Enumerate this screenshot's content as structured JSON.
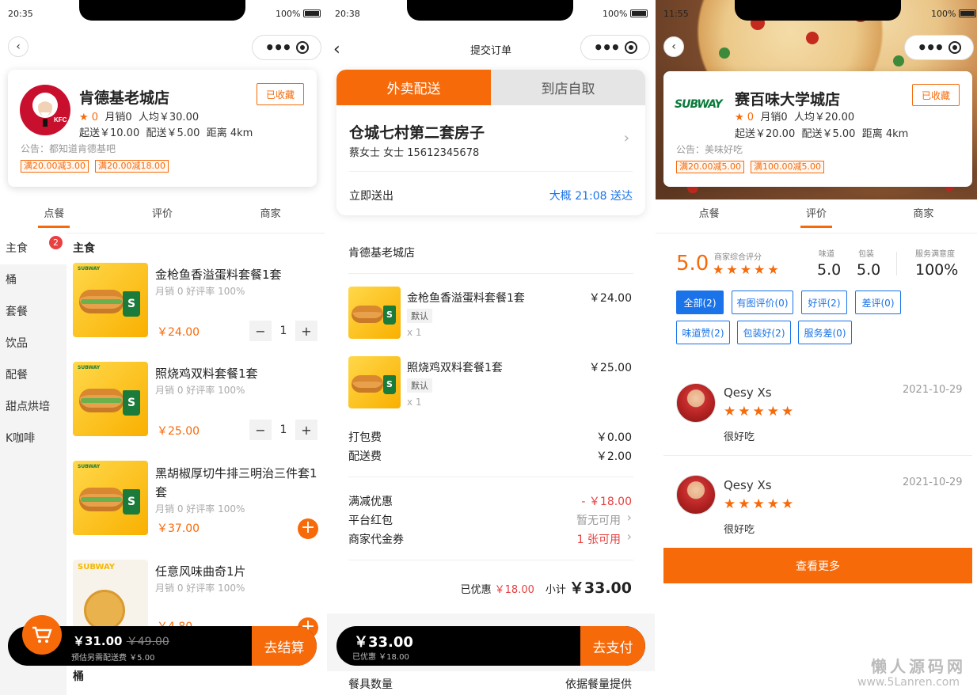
{
  "colors": {
    "accent": "#f66a0a",
    "link": "#1a73e8",
    "red": "#e94040"
  },
  "p1": {
    "time": "20:35",
    "battery": "100%",
    "shop": {
      "name": "肯德基老城店",
      "rating": "0",
      "sales": "月销0",
      "avg": "人均￥30.00",
      "start": "起送￥10.00",
      "delivery": "配送￥5.00",
      "distance": "距离 4km",
      "fav": "已收藏",
      "notice": "公告：都知道肯德基吧",
      "promos": [
        "满20.00减3.00",
        "满20.00减18.00"
      ]
    },
    "tabs": [
      "点餐",
      "评价",
      "商家"
    ],
    "categories": [
      {
        "label": "主食",
        "badge": "2"
      },
      {
        "label": "桶"
      },
      {
        "label": "套餐"
      },
      {
        "label": "饮品"
      },
      {
        "label": "配餐"
      },
      {
        "label": "甜点烘培"
      },
      {
        "label": "K咖啡"
      }
    ],
    "section": "主食",
    "items": [
      {
        "name": "金枪鱼香溢蛋料套餐1套",
        "sub": "月销 0 好评率 100%",
        "price": "￥24.00",
        "qty": "1"
      },
      {
        "name": "照烧鸡双料套餐1套",
        "sub": "月销 0 好评率 100%",
        "price": "￥25.00",
        "qty": "1"
      },
      {
        "name": "黑胡椒厚切牛排三明治三件套1套",
        "sub": "月销 0 好评率 100%",
        "price": "￥37.00"
      },
      {
        "name": "任意风味曲奇1片",
        "sub": "月销 0 好评率 100%",
        "price": "￥4.80"
      }
    ],
    "cart": {
      "total": "￥31.00",
      "old": "￥49.00",
      "note": "预估另需配送费 ￥5.00",
      "checkout": "去结算"
    },
    "next_section": "桶"
  },
  "p2": {
    "time": "20:38",
    "battery": "100%",
    "title": "提交订单",
    "modes": [
      "外卖配送",
      "到店自取"
    ],
    "address": {
      "line": "仓城七村第二套房子",
      "contact": "蔡女士 女士 15612345678"
    },
    "deliver_now": "立即送出",
    "eta": "大概 21:08 送达",
    "shop": "肯德基老城店",
    "items": [
      {
        "name": "金枪鱼香溢蛋料套餐1套",
        "tag": "默认",
        "qty": "x 1",
        "price": "￥24.00"
      },
      {
        "name": "照烧鸡双料套餐1套",
        "tag": "默认",
        "qty": "x 1",
        "price": "￥25.00"
      }
    ],
    "fees": [
      {
        "label": "打包费",
        "value": "￥0.00"
      },
      {
        "label": "配送费",
        "value": "￥2.00"
      }
    ],
    "discounts": [
      {
        "label": "满减优惠",
        "value": "- ￥18.00"
      },
      {
        "label": "平台红包",
        "value": "暂无可用"
      },
      {
        "label": "商家代金券",
        "value": "1 张可用"
      }
    ],
    "summary": {
      "saved_label": "已优惠",
      "saved": "￥18.00",
      "subtotal_label": "小计",
      "subtotal": "￥33.00"
    },
    "bar": {
      "total": "￥33.00",
      "saved": "已优惠 ￥18.00",
      "pay": "去支付"
    },
    "bottom": {
      "label": "餐具数量",
      "value": "依据餐量提供"
    }
  },
  "p3": {
    "time": "11:55",
    "battery": "100%",
    "shop": {
      "name": "赛百味大学城店",
      "rating": "0",
      "sales": "月销0",
      "avg": "人均￥20.00",
      "start": "起送￥20.00",
      "delivery": "配送￥5.00",
      "distance": "距离 4km",
      "fav": "已收藏",
      "notice": "公告：美味好吃",
      "promos": [
        "满20.00减5.00",
        "满100.00减5.00"
      ],
      "logo": "SUBWAY"
    },
    "tabs": [
      "点餐",
      "评价",
      "商家"
    ],
    "score": "5.0",
    "score_label": "商家综合评分",
    "taste_label": "味道",
    "taste": "5.0",
    "pack_label": "包装",
    "pack": "5.0",
    "service_label": "服务满意度",
    "service": "100%",
    "chips": [
      "全部(2)",
      "有图评价(0)",
      "好评(2)",
      "差评(0)",
      "味道赞(2)",
      "包装好(2)",
      "服务差(0)"
    ],
    "reviews": [
      {
        "name": "Qesy Xs",
        "date": "2021-10-29",
        "text": "很好吃"
      },
      {
        "name": "Qesy Xs",
        "date": "2021-10-29",
        "text": "很好吃"
      }
    ],
    "more": "查看更多"
  },
  "watermark": {
    "title": "懒人源码网",
    "url": "www.5Lanren.com"
  }
}
